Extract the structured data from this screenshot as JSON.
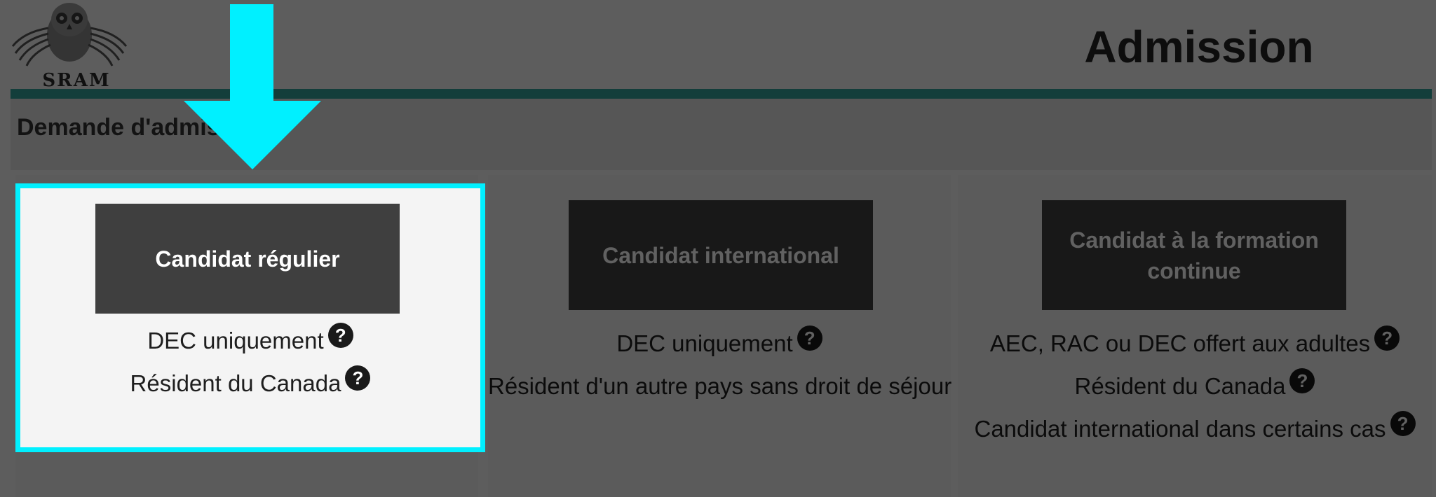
{
  "logo": {
    "text": "SRAM"
  },
  "page_title": "Admission",
  "section_title": "Demande d'admission",
  "cards": [
    {
      "button_label": "Candidat régulier",
      "criteria": [
        "DEC uniquement",
        "Résident du Canada"
      ]
    },
    {
      "button_label": "Candidat international",
      "criteria": [
        "DEC uniquement",
        "Résident d'un autre pays sans droit de séjour"
      ]
    },
    {
      "button_label": "Candidat à la formation continue",
      "criteria": [
        "AEC, RAC ou DEC offert aux adultes",
        "Résident du Canada",
        "Candidat international dans certains cas"
      ]
    }
  ],
  "help_icon_glyph": "?",
  "colors": {
    "accent": "#00f0ff",
    "header_rule": "#33a39b",
    "button_bg": "#3f3f3f"
  },
  "icons": [
    "owl-logo-icon",
    "help-icon",
    "pointer-arrow-icon"
  ]
}
